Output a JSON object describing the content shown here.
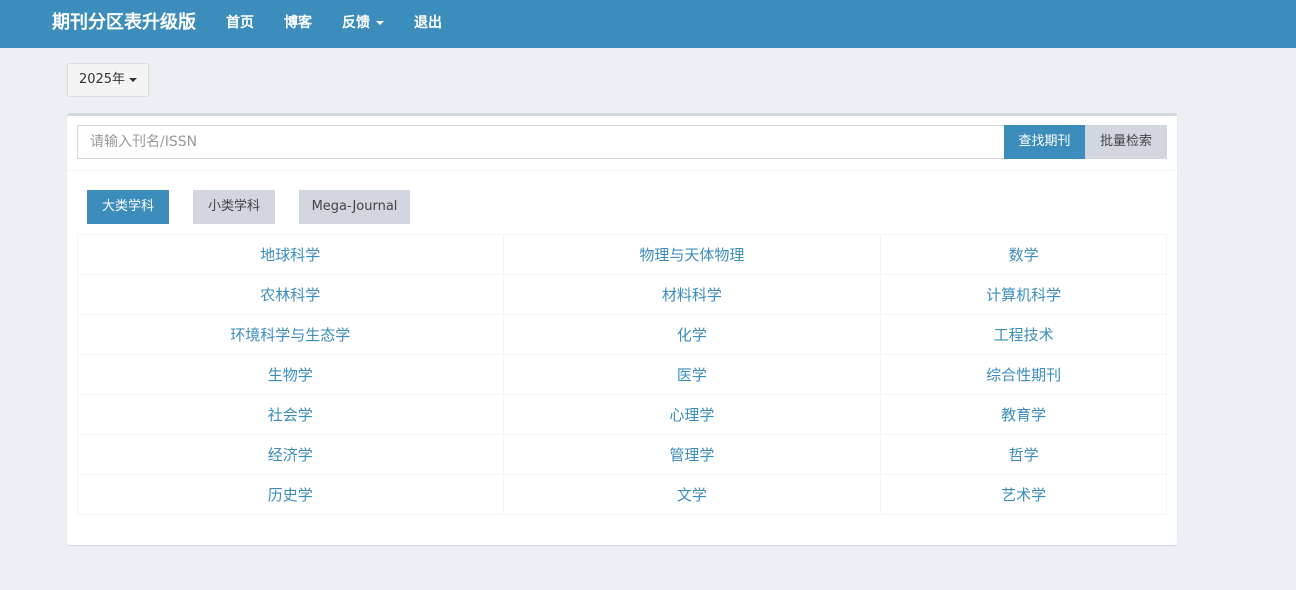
{
  "navbar": {
    "brand": "期刊分区表升级版",
    "items": [
      {
        "label": "首页"
      },
      {
        "label": "博客"
      },
      {
        "label": "反馈",
        "has_dropdown": true
      },
      {
        "label": "退出"
      }
    ],
    "background": "#3c8dbc"
  },
  "year_selector": {
    "label": "2025年"
  },
  "search": {
    "placeholder": "请输入刊名/ISSN",
    "value": "",
    "find_label": "查找期刊",
    "batch_label": "批量检索"
  },
  "tabs": [
    {
      "label": "大类学科",
      "active": true
    },
    {
      "label": "小类学科",
      "active": false
    },
    {
      "label": "Mega-Journal",
      "active": false
    }
  ],
  "subjects": [
    [
      "地球科学",
      "物理与天体物理",
      "数学"
    ],
    [
      "农林科学",
      "材料科学",
      "计算机科学"
    ],
    [
      "环境科学与生态学",
      "化学",
      "工程技术"
    ],
    [
      "生物学",
      "医学",
      "综合性期刊"
    ],
    [
      "社会学",
      "心理学",
      "教育学"
    ],
    [
      "经济学",
      "管理学",
      "哲学"
    ],
    [
      "历史学",
      "文学",
      "艺术学"
    ]
  ],
  "colors": {
    "accent": "#3c8dbc",
    "background": "#ecf0f5",
    "muted_button": "#d2d6de"
  }
}
